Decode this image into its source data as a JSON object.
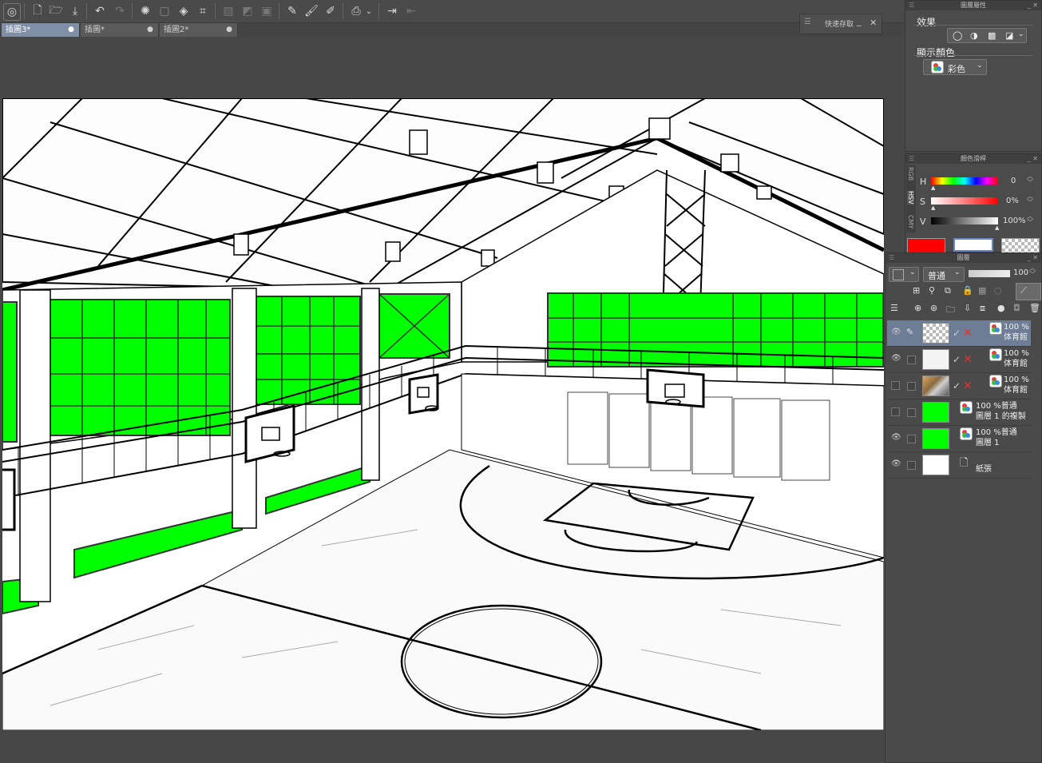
{
  "document_tabs": [
    {
      "label": "插圖3*",
      "active": true
    },
    {
      "label": "插圖*",
      "active": false
    },
    {
      "label": "插圖2*",
      "active": false
    }
  ],
  "quick_save": {
    "title": "快速存取"
  },
  "layer_property": {
    "title": "圖層屬性",
    "effect_label": "效果",
    "display_color_label": "顯示顏色",
    "display_color_value": "彩色"
  },
  "color_slider": {
    "title": "顏色滑桿",
    "side_tabs": [
      "RGB",
      "HSV",
      "CMY"
    ],
    "h_label": "H",
    "h_value": "0",
    "s_label": "S",
    "s_value": "0%",
    "v_label": "V",
    "v_value": "100%",
    "main_color": "#ff0000",
    "sub_color": "#ffffff"
  },
  "layers_panel": {
    "title": "圖層",
    "blend_mode": "普通",
    "opacity": "100",
    "layers": [
      {
        "line1": "100 %",
        "line2": "体育館",
        "thumb": "checker",
        "selected": true,
        "visible": true,
        "type": "3d"
      },
      {
        "line1": "100 %",
        "line2": "体育館",
        "thumb": "white",
        "selected": false,
        "visible": true,
        "type": "3d"
      },
      {
        "line1": "100 %",
        "line2": "体育館",
        "thumb": "photo",
        "selected": false,
        "visible": false,
        "type": "3d"
      },
      {
        "line1": "100 %普通",
        "line2": "圖層 1 的複製",
        "thumb": "green",
        "selected": false,
        "visible": false,
        "type": "raster"
      },
      {
        "line1": "100 %普通",
        "line2": "圖層 1",
        "thumb": "green",
        "selected": false,
        "visible": true,
        "type": "raster"
      },
      {
        "line1": "",
        "line2": "紙張",
        "thumb": "paper",
        "selected": false,
        "visible": true,
        "type": "paper"
      }
    ]
  },
  "colors": {
    "accent_green": "#00ff00",
    "selection": "#6e7d96",
    "active_tab": "#7f8fa6"
  },
  "canvas_content": {
    "subject": "gymnasium-line-art"
  }
}
